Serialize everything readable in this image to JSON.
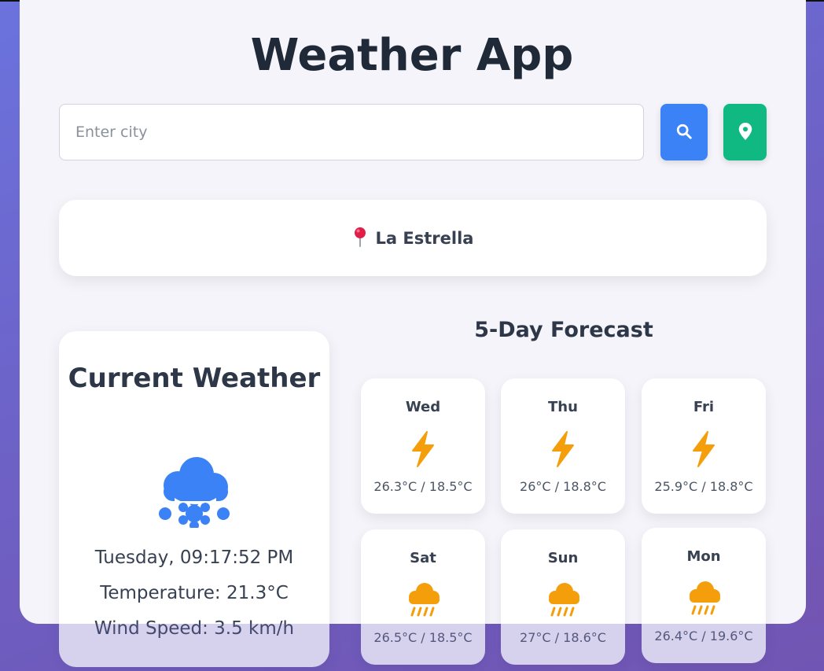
{
  "app": {
    "title": "Weather App"
  },
  "search": {
    "placeholder": "Enter city",
    "value": ""
  },
  "location": {
    "name": "La Estrella"
  },
  "current": {
    "title": "Current Weather",
    "datetime": "Tuesday, 09:17:52 PM",
    "temperature": "Temperature: 21.3°C",
    "wind": "Wind Speed: 3.5 km/h",
    "icon": "snow-cloud-icon"
  },
  "forecast": {
    "title": "5-Day Forecast",
    "days": [
      {
        "day": "Wed",
        "temps": "26.3°C / 18.5°C",
        "icon": "thunder-icon"
      },
      {
        "day": "Thu",
        "temps": "26°C / 18.8°C",
        "icon": "thunder-icon"
      },
      {
        "day": "Fri",
        "temps": "25.9°C / 18.8°C",
        "icon": "thunder-icon"
      },
      {
        "day": "Sat",
        "temps": "26.5°C / 18.5°C",
        "icon": "rain-cloud-icon"
      },
      {
        "day": "Sun",
        "temps": "27°C / 18.6°C",
        "icon": "rain-cloud-icon"
      },
      {
        "day": "Mon",
        "temps": "26.4°C / 19.6°C",
        "icon": "rain-cloud-icon"
      }
    ]
  },
  "colors": {
    "search_button": "#3b82f6",
    "locate_button": "#10b981",
    "icon_blue": "#3b82f6",
    "icon_amber": "#f59e0b"
  }
}
